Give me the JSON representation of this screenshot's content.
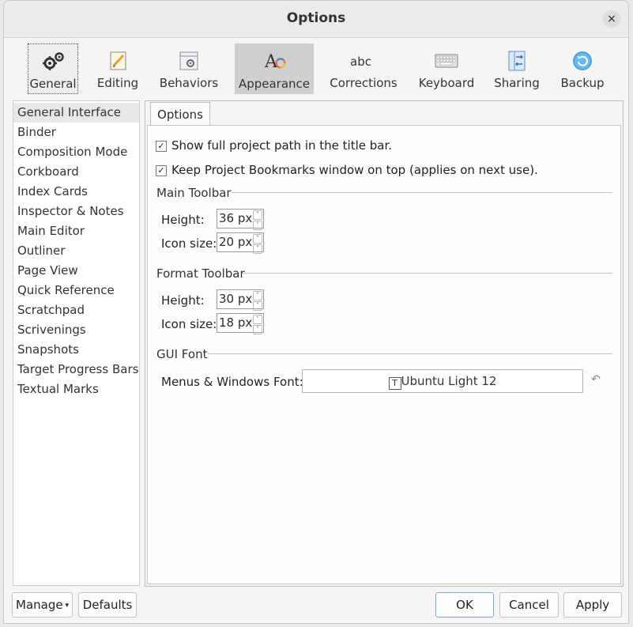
{
  "window": {
    "title": "Options",
    "close_glyph": "×"
  },
  "toolbar": {
    "items": [
      {
        "label": "General",
        "icon": "gears-icon"
      },
      {
        "label": "Editing",
        "icon": "pencil-note-icon"
      },
      {
        "label": "Behaviors",
        "icon": "window-gear-icon"
      },
      {
        "label": "Appearance",
        "icon": "font-palette-icon"
      },
      {
        "label": "Corrections",
        "icon": "abc-icon"
      },
      {
        "label": "Keyboard",
        "icon": "keyboard-icon"
      },
      {
        "label": "Sharing",
        "icon": "sync-arrows-icon"
      },
      {
        "label": "Backup",
        "icon": "backup-circle-icon"
      }
    ],
    "abc_text": "abc"
  },
  "sidebar": {
    "items": [
      "General Interface",
      "Binder",
      "Composition Mode",
      "Corkboard",
      "Index Cards",
      "Inspector & Notes",
      "Main Editor",
      "Outliner",
      "Page View",
      "Quick Reference",
      "Scratchpad",
      "Scrivenings",
      "Snapshots",
      "Target Progress Bars",
      "Textual Marks"
    ]
  },
  "panel": {
    "tab": "Options",
    "checkbox_full_path": "Show full project path in the title bar.",
    "checkbox_bookmarks": "Keep Project Bookmarks window on top (applies on next use).",
    "main_toolbar": {
      "heading": "Main Toolbar",
      "height_label": "Height:",
      "height_value": "36 px",
      "icon_label": "Icon size:",
      "icon_value": "20 px"
    },
    "format_toolbar": {
      "heading": "Format Toolbar",
      "height_label": "Height:",
      "height_value": "30 px",
      "icon_label": "Icon size:",
      "icon_value": "18 px"
    },
    "gui_font": {
      "heading": "GUI Font",
      "label": "Menus & Windows Font:",
      "value": "Ubuntu Light 12"
    }
  },
  "footer": {
    "manage": "Manage",
    "defaults": "Defaults",
    "ok": "OK",
    "cancel": "Cancel",
    "apply": "Apply"
  },
  "colors": {
    "selected_tool_bg": "#cfcfcf",
    "accent_border": "#7aa7d8"
  }
}
